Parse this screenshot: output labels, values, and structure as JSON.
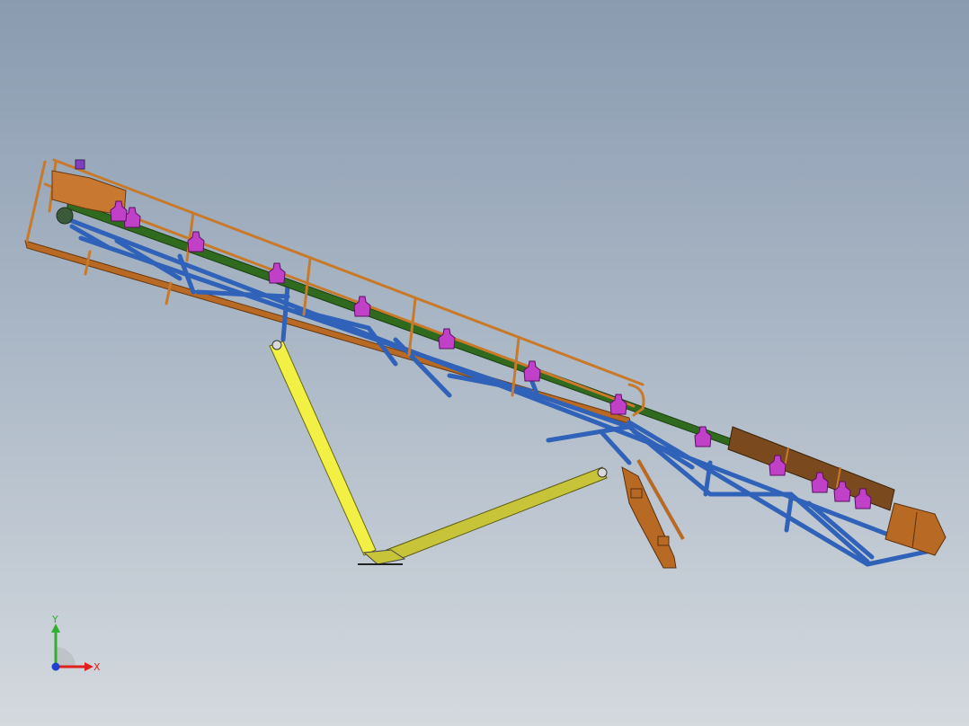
{
  "viewport": {
    "background_top": "#8a9bb0",
    "background_bottom": "#d4d9de"
  },
  "model": {
    "colors": {
      "frame_blue": "#2f62b8",
      "rail_orange": "#c87a2a",
      "stringer_brown": "#b86a24",
      "belt_green": "#2f6a1e",
      "idler_magenta": "#c040c8",
      "strut_yellow": "#f2f044",
      "strut_olive": "#c8c43a",
      "hopper_brown": "#7a4a1e",
      "drive_orange": "#c87830"
    },
    "idler_count": 13
  },
  "triad": {
    "y_label": "Y",
    "x_label": "X",
    "y_color": "#2fb02f",
    "x_color": "#e02020",
    "z_color": "#2040d0"
  }
}
